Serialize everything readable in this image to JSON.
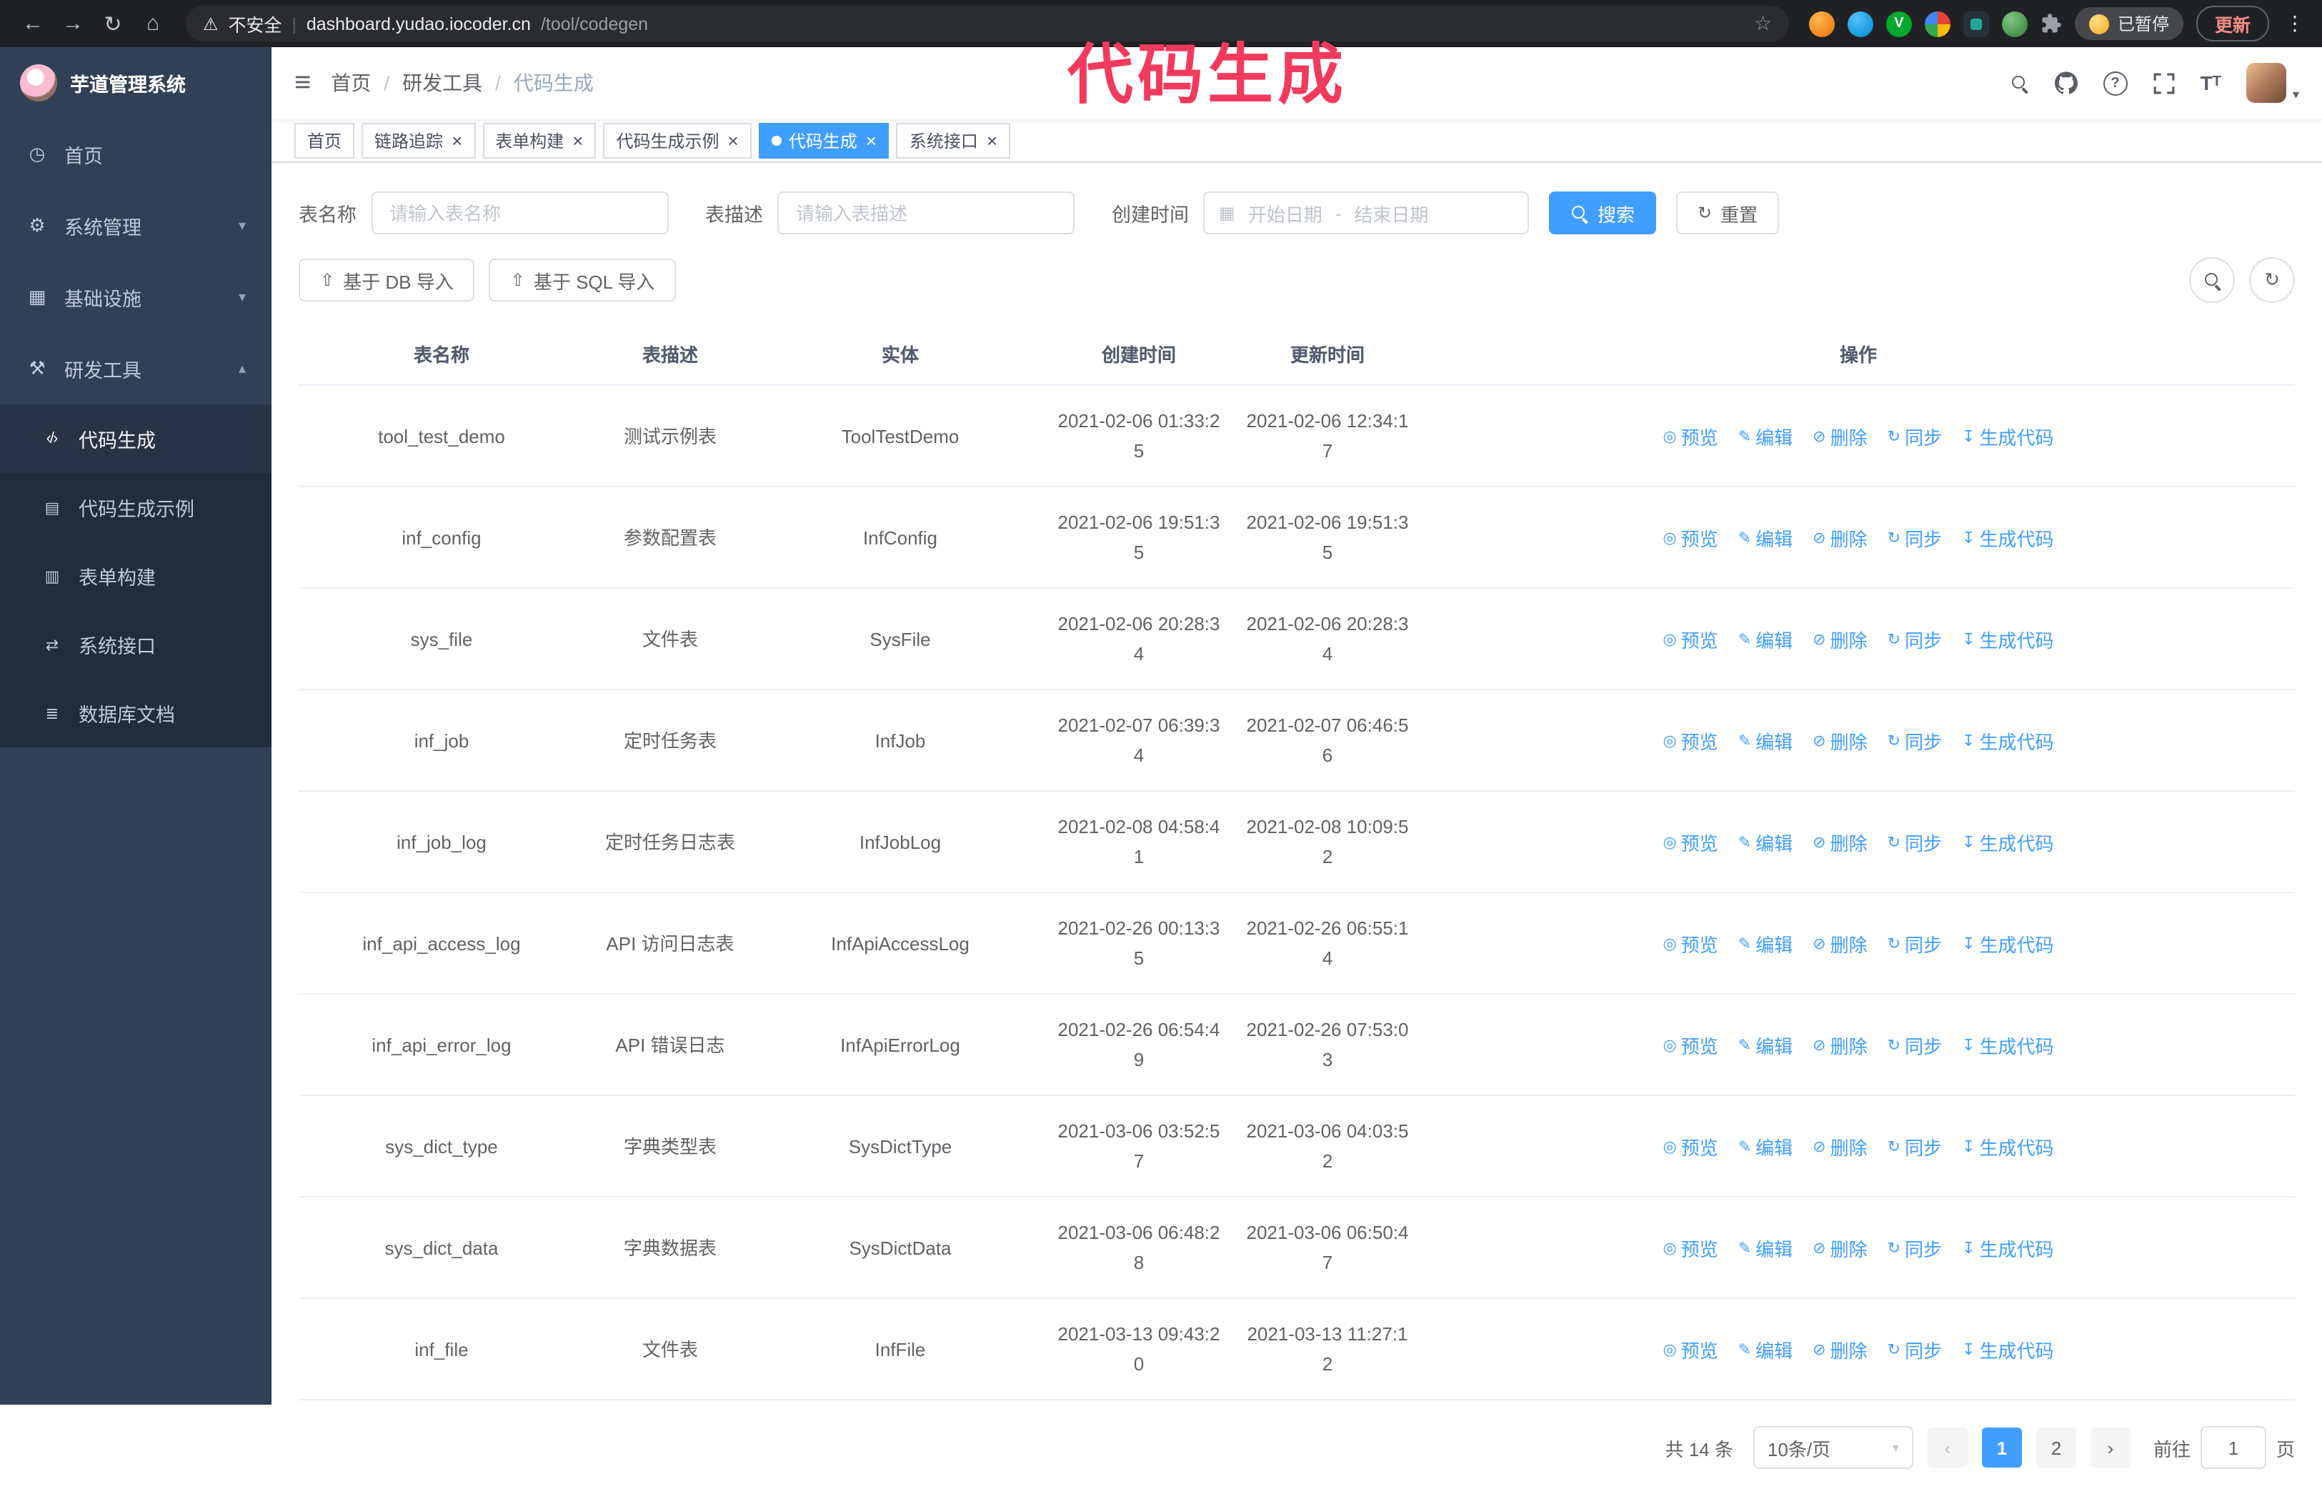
{
  "colors": {
    "accent": "#409EFF",
    "sidebar_bg": "#304156",
    "submenu_bg": "#1f2d3d",
    "annotation": "#f23a5f"
  },
  "browser": {
    "security_label": "不安全",
    "url_host": "dashboard.yudao.iocoder.cn",
    "url_path": "/tool/codegen",
    "paused_badge": "已暂停",
    "update_button": "更新"
  },
  "annotation": {
    "text": "代码生成"
  },
  "sidebar": {
    "logo_title": "芋道管理系统",
    "items": [
      {
        "id": "home",
        "icon": "dashboard",
        "label": "首页"
      },
      {
        "id": "system",
        "icon": "gear",
        "label": "系统管理",
        "expandable": true
      },
      {
        "id": "infra",
        "icon": "infra",
        "label": "基础设施",
        "expandable": true
      },
      {
        "id": "devtools",
        "icon": "tools",
        "label": "研发工具",
        "expandable": true,
        "expanded": true,
        "children": [
          {
            "id": "codegen",
            "icon": "code",
            "label": "代码生成",
            "active": true
          },
          {
            "id": "codegen-example",
            "icon": "example",
            "label": "代码生成示例"
          },
          {
            "id": "form-builder",
            "icon": "form",
            "label": "表单构建"
          },
          {
            "id": "api",
            "icon": "api",
            "label": "系统接口"
          },
          {
            "id": "db-doc",
            "icon": "db",
            "label": "数据库文档"
          }
        ]
      }
    ]
  },
  "breadcrumb": [
    "首页",
    "研发工具",
    "代码生成"
  ],
  "tabs": [
    {
      "label": "首页",
      "closable": false,
      "active": false
    },
    {
      "label": "链路追踪",
      "closable": true,
      "active": false
    },
    {
      "label": "表单构建",
      "closable": true,
      "active": false
    },
    {
      "label": "代码生成示例",
      "closable": true,
      "active": false
    },
    {
      "label": "代码生成",
      "closable": true,
      "active": true
    },
    {
      "label": "系统接口",
      "closable": true,
      "active": false
    }
  ],
  "filters": {
    "table_name_label": "表名称",
    "table_name_placeholder": "请输入表名称",
    "table_desc_label": "表描述",
    "table_desc_placeholder": "请输入表描述",
    "create_time_label": "创建时间",
    "date_start_placeholder": "开始日期",
    "date_separator": "-",
    "date_end_placeholder": "结束日期",
    "search_button": "搜索",
    "reset_button": "重置"
  },
  "toolbar": {
    "import_db_button": "基于 DB 导入",
    "import_sql_button": "基于 SQL 导入"
  },
  "table": {
    "columns": [
      "表名称",
      "表描述",
      "实体",
      "创建时间",
      "更新时间",
      "操作"
    ],
    "actions": [
      {
        "id": "preview",
        "icon": "eye",
        "label": "预览"
      },
      {
        "id": "edit",
        "icon": "edit",
        "label": "编辑"
      },
      {
        "id": "delete",
        "icon": "trash",
        "label": "删除"
      },
      {
        "id": "sync",
        "icon": "sync",
        "label": "同步"
      },
      {
        "id": "generate",
        "icon": "download",
        "label": "生成代码"
      }
    ],
    "rows": [
      {
        "name": "tool_test_demo",
        "desc": "测试示例表",
        "entity": "ToolTestDemo",
        "created": "2021-02-06 01:33:25",
        "updated": "2021-02-06 12:34:17"
      },
      {
        "name": "inf_config",
        "desc": "参数配置表",
        "entity": "InfConfig",
        "created": "2021-02-06 19:51:35",
        "updated": "2021-02-06 19:51:35"
      },
      {
        "name": "sys_file",
        "desc": "文件表",
        "entity": "SysFile",
        "created": "2021-02-06 20:28:34",
        "updated": "2021-02-06 20:28:34"
      },
      {
        "name": "inf_job",
        "desc": "定时任务表",
        "entity": "InfJob",
        "created": "2021-02-07 06:39:34",
        "updated": "2021-02-07 06:46:56"
      },
      {
        "name": "inf_job_log",
        "desc": "定时任务日志表",
        "entity": "InfJobLog",
        "created": "2021-02-08 04:58:41",
        "updated": "2021-02-08 10:09:52"
      },
      {
        "name": "inf_api_access_log",
        "desc": "API 访问日志表",
        "entity": "InfApiAccessLog",
        "created": "2021-02-26 00:13:35",
        "updated": "2021-02-26 06:55:14"
      },
      {
        "name": "inf_api_error_log",
        "desc": "API 错误日志",
        "entity": "InfApiErrorLog",
        "created": "2021-02-26 06:54:49",
        "updated": "2021-02-26 07:53:03"
      },
      {
        "name": "sys_dict_type",
        "desc": "字典类型表",
        "entity": "SysDictType",
        "created": "2021-03-06 03:52:57",
        "updated": "2021-03-06 04:03:52"
      },
      {
        "name": "sys_dict_data",
        "desc": "字典数据表",
        "entity": "SysDictData",
        "created": "2021-03-06 06:48:28",
        "updated": "2021-03-06 06:50:47"
      },
      {
        "name": "inf_file",
        "desc": "文件表",
        "entity": "InfFile",
        "created": "2021-03-13 09:43:20",
        "updated": "2021-03-13 11:27:12"
      }
    ]
  },
  "pagination": {
    "total_text": "共 14 条",
    "page_size": "10条/页",
    "pages": [
      "1",
      "2"
    ],
    "active_page": "1",
    "goto_label": "前往",
    "goto_value": "1",
    "goto_suffix": "页"
  }
}
